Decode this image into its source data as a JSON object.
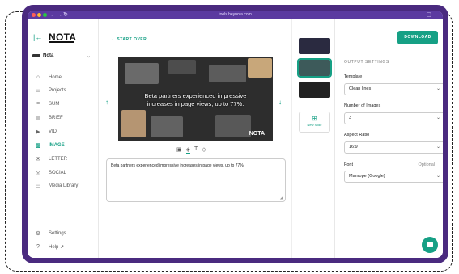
{
  "browser": {
    "url": "tools.heynota.com",
    "dots": [
      "#ff5f57",
      "#febc2e",
      "#28c840"
    ],
    "nav": [
      "←",
      "→",
      "↻"
    ]
  },
  "sidebar": {
    "logo": "NOTA",
    "workspace": "Nota",
    "items": [
      {
        "label": "Home",
        "icon": "⌂"
      },
      {
        "label": "Projects",
        "icon": "▭"
      },
      {
        "label": "SUM",
        "icon": "≡"
      },
      {
        "label": "BRIEF",
        "icon": "▤"
      },
      {
        "label": "VID",
        "icon": "▶"
      },
      {
        "label": "IMAGE",
        "icon": "▨"
      },
      {
        "label": "LETTER",
        "icon": "✉"
      },
      {
        "label": "SOCIAL",
        "icon": "◎"
      },
      {
        "label": "Media Library",
        "icon": "▭"
      }
    ],
    "bottom": [
      {
        "label": "Settings",
        "icon": "⚙"
      },
      {
        "label": "Help ↗",
        "icon": "?"
      }
    ]
  },
  "main": {
    "start_over": "← START OVER",
    "slide_text": "Beta partners experienced impressive increases in page views, up to 77%.",
    "slide_logo": "NOTA",
    "textbox_value": "Beta partners experienced impressive increases in page views, up to 77%."
  },
  "thumbs": {
    "new_slide": "New Slide"
  },
  "settings": {
    "download": "DOWNLOAD",
    "title": "OUTPUT SETTINGS",
    "template_label": "Template",
    "template_value": "Clean lines",
    "num_images_label": "Number of Images",
    "num_images_value": "3",
    "aspect_label": "Aspect Ratio",
    "aspect_value": "16:9",
    "font_label": "Font",
    "font_optional": "Optional",
    "font_value": "Manrope (Google)"
  },
  "colors": {
    "accent": "#16a085",
    "frame": "#4a2a7f"
  }
}
